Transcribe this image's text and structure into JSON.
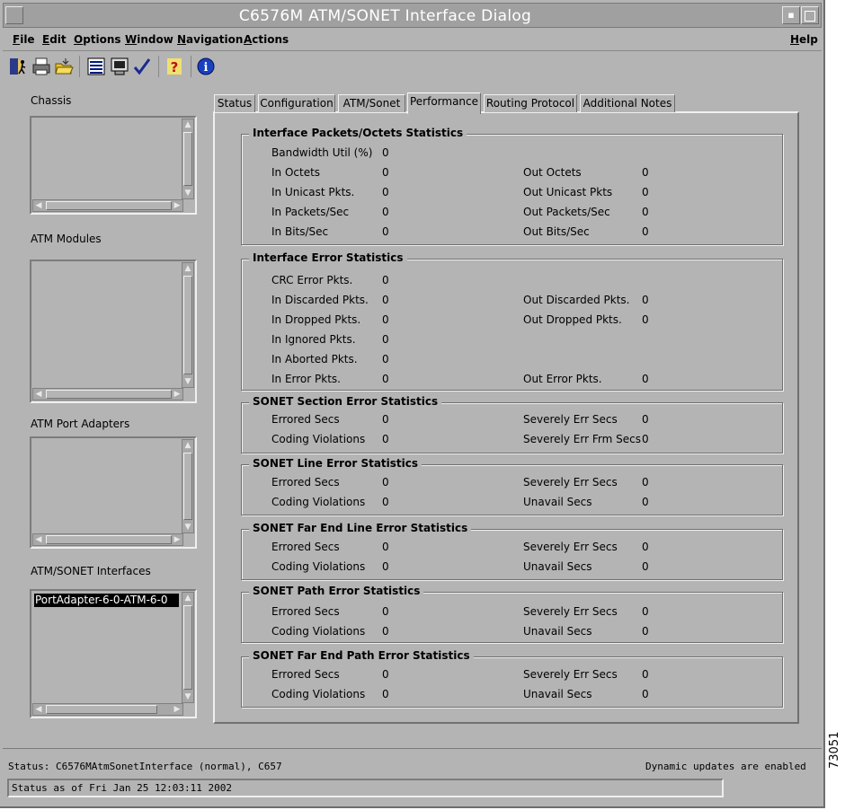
{
  "window": {
    "title": "C6576M ATM/SONET Interface Dialog"
  },
  "menu": [
    "File",
    "Edit",
    "Options",
    "Window",
    "Navigation",
    "Actions"
  ],
  "help_menu": "Help",
  "toolbar_icons": [
    "exit-icon",
    "print-icon",
    "open-folder-icon",
    "list-icon",
    "monitor-icon",
    "check-icon",
    "help-question-icon",
    "info-icon"
  ],
  "left_panel": {
    "chassis_label": "Chassis",
    "modules_label": "ATM Modules",
    "port_adapters_label": "ATM Port Adapters",
    "interfaces_label": "ATM/SONET Interfaces",
    "interfaces_selected": "PortAdapter-6-0-ATM-6-0"
  },
  "tabs": [
    "Status",
    "Configuration",
    "ATM/Sonet",
    "Performance",
    "Routing Protocol",
    "Additional Notes"
  ],
  "active_tab": "Performance",
  "groups": [
    {
      "title": "Interface Packets/Octets Statistics",
      "rows": [
        {
          "l": "Bandwidth Util (%)",
          "lv": "0",
          "r": "",
          "rv": ""
        },
        {
          "l": "In Octets",
          "lv": "0",
          "r": "Out Octets",
          "rv": "0"
        },
        {
          "l": "In Unicast Pkts.",
          "lv": "0",
          "r": "Out Unicast Pkts",
          "rv": "0"
        },
        {
          "l": "In Packets/Sec",
          "lv": "0",
          "r": "Out Packets/Sec",
          "rv": "0"
        },
        {
          "l": "In Bits/Sec",
          "lv": "0",
          "r": "Out Bits/Sec",
          "rv": "0"
        }
      ]
    },
    {
      "title": "Interface Error Statistics",
      "rows": [
        {
          "l": "CRC Error Pkts.",
          "lv": "0",
          "r": "",
          "rv": ""
        },
        {
          "l": "In Discarded Pkts.",
          "lv": "0",
          "r": "Out Discarded Pkts.",
          "rv": "0"
        },
        {
          "l": "In Dropped Pkts.",
          "lv": "0",
          "r": "Out Dropped Pkts.",
          "rv": "0"
        },
        {
          "l": "In Ignored Pkts.",
          "lv": "0",
          "r": "",
          "rv": ""
        },
        {
          "l": "In Aborted Pkts.",
          "lv": "0",
          "r": "",
          "rv": ""
        },
        {
          "l": "In Error Pkts.",
          "lv": "0",
          "r": "Out Error Pkts.",
          "rv": "0"
        }
      ]
    },
    {
      "title": "SONET Section Error Statistics",
      "rows": [
        {
          "l": "Errored Secs",
          "lv": "0",
          "r": "Severely Err Secs",
          "rv": "0"
        },
        {
          "l": "Coding Violations",
          "lv": "0",
          "r": "Severely Err Frm Secs",
          "rv": "0"
        }
      ]
    },
    {
      "title": "SONET Line Error Statistics",
      "rows": [
        {
          "l": "Errored Secs",
          "lv": "0",
          "r": "Severely Err Secs",
          "rv": "0"
        },
        {
          "l": "Coding Violations",
          "lv": "0",
          "r": "Unavail Secs",
          "rv": "0"
        }
      ]
    },
    {
      "title": "SONET Far End Line Error Statistics",
      "rows": [
        {
          "l": "Errored Secs",
          "lv": "0",
          "r": "Severely Err Secs",
          "rv": "0"
        },
        {
          "l": "Coding Violations",
          "lv": "0",
          "r": "Unavail Secs",
          "rv": "0"
        }
      ]
    },
    {
      "title": "SONET Path Error Statistics",
      "rows": [
        {
          "l": "Errored Secs",
          "lv": "0",
          "r": "Severely Err Secs",
          "rv": "0"
        },
        {
          "l": "Coding Violations",
          "lv": "0",
          "r": "Unavail Secs",
          "rv": "0"
        }
      ]
    },
    {
      "title": "SONET Far End Path Error Statistics",
      "rows": [
        {
          "l": "Errored Secs",
          "lv": "0",
          "r": "Severely Err Secs",
          "rv": "0"
        },
        {
          "l": "Coding Violations",
          "lv": "0",
          "r": "Unavail Secs",
          "rv": "0"
        }
      ]
    }
  ],
  "status": {
    "line": "Status: C6576MAtmSonetInterface (normal), C657",
    "dynamic": "Dynamic updates are enabled",
    "as_of": "Status as of Fri Jan 25 12:03:11 2002"
  },
  "figure_id": "73051"
}
